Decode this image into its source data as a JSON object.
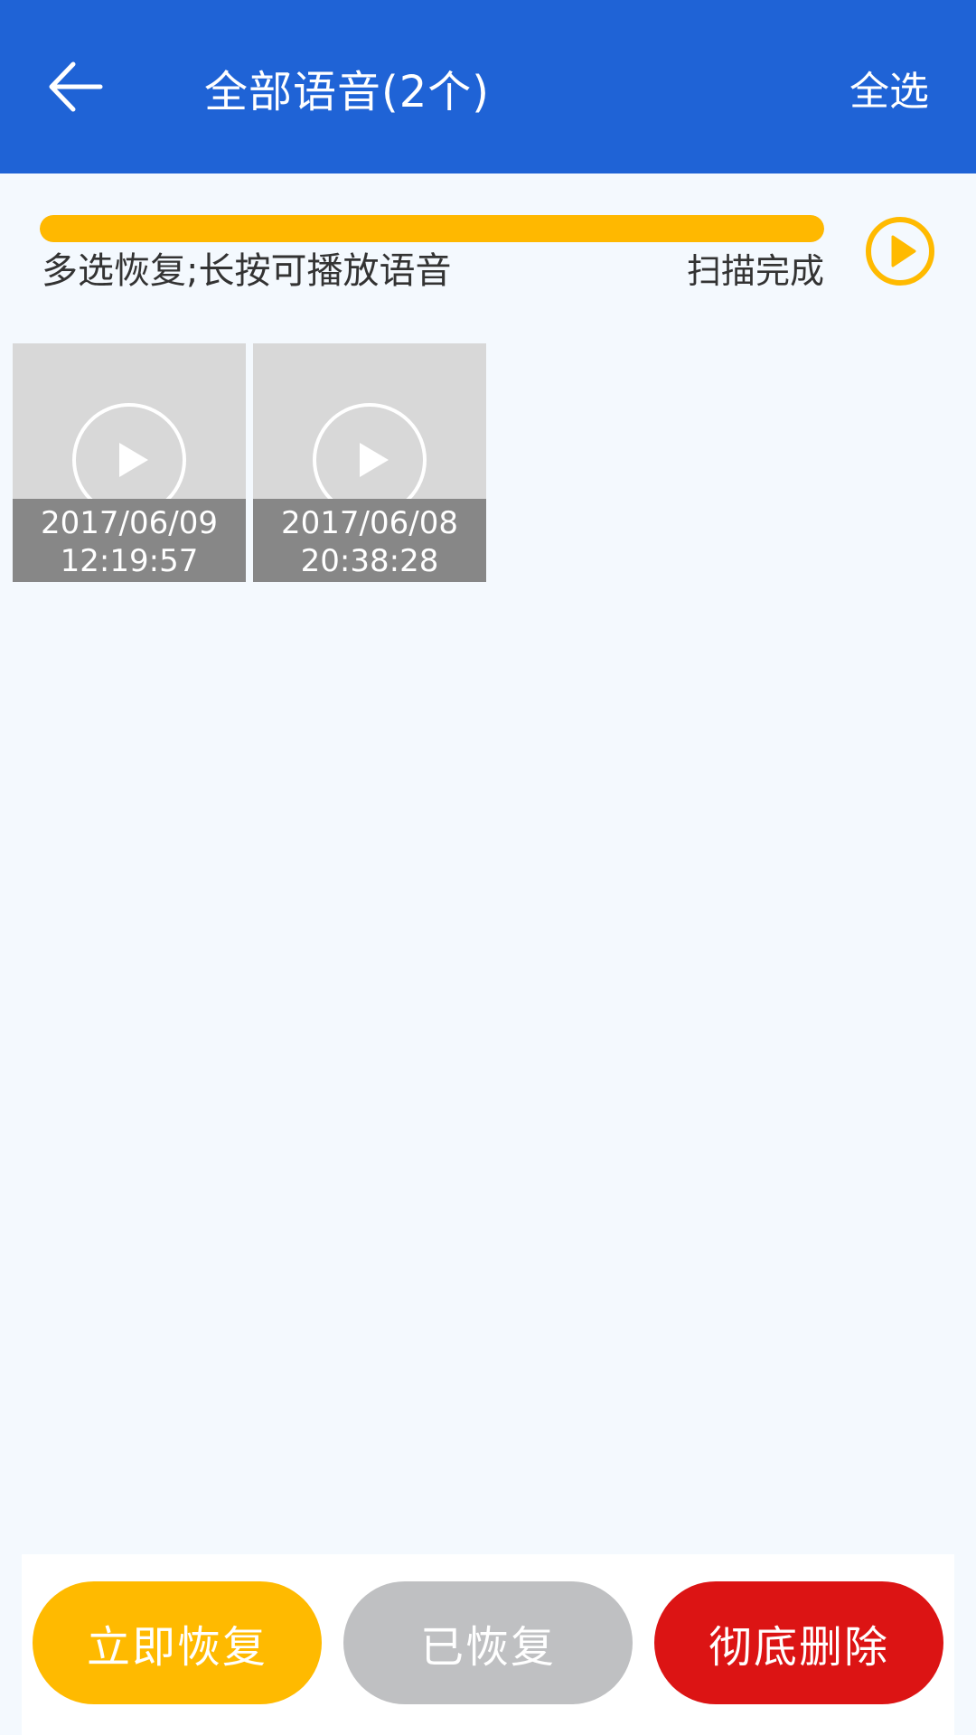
{
  "header": {
    "title": "全部语音(2个)",
    "select_all_label": "全选",
    "back_icon": "arrow-left-icon"
  },
  "scan": {
    "progress_percent": 100,
    "hint_text": "多选恢复;长按可播放语音",
    "status_text": "扫描完成",
    "play_icon": "play-circle-icon"
  },
  "voice_items": [
    {
      "date": "2017/06/09",
      "time": "12:19:57"
    },
    {
      "date": "2017/06/08",
      "time": "20:38:28"
    }
  ],
  "actions": {
    "restore_label": "立即恢复",
    "restored_label": "已恢复",
    "delete_label": "彻底删除"
  },
  "colors": {
    "app_bar": "#1F63D6",
    "accent_yellow": "#FFBA00",
    "neutral_gray": "#BFC0C2",
    "danger_red": "#DC1414"
  }
}
